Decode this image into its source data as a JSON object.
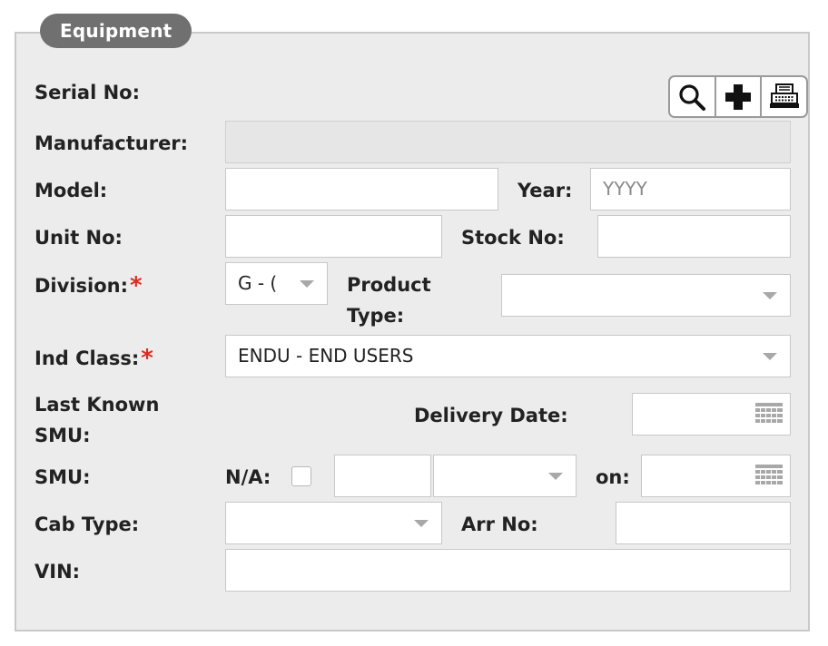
{
  "section": {
    "title": "Equipment"
  },
  "toolbar": {
    "search_icon": "search-icon",
    "add_icon": "plus-icon",
    "print_icon": "printer-icon"
  },
  "labels": {
    "serial_no": "Serial No:",
    "manufacturer": "Manufacturer:",
    "model": "Model:",
    "year": "Year:",
    "unit_no": "Unit No:",
    "stock_no": "Stock No:",
    "division": "Division:",
    "product_type_line1": "Product",
    "product_type_line2": "Type:",
    "ind_class": "Ind Class:",
    "last_known_smu_line1": "Last Known",
    "last_known_smu_line2": "SMU:",
    "delivery_date": "Delivery Date:",
    "smu": "SMU:",
    "na": "N/A:",
    "on": "on:",
    "cab_type": "Cab Type:",
    "arr_no": "Arr No:",
    "vin": "VIN:"
  },
  "required_marker": "*",
  "fields": {
    "manufacturer": "",
    "model": "",
    "year_placeholder": "YYYY",
    "unit_no": "",
    "stock_no": "",
    "division_selected": "G - (",
    "product_type_selected": "",
    "ind_class_selected": "ENDU - END USERS",
    "delivery_date": "",
    "smu_value": "",
    "smu_unit_selected": "",
    "smu_on_date": "",
    "cab_type_selected": "",
    "arr_no": "",
    "vin": "",
    "na_checked": false
  },
  "colors": {
    "panel_bg": "#ececec",
    "legend_bg": "#707070",
    "required": "#e02b20"
  }
}
